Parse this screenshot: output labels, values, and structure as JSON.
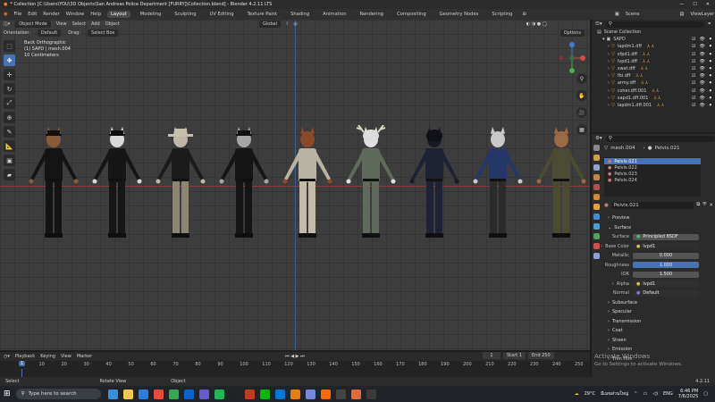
{
  "window": {
    "title": "* Collection [C:\\Users\\YOU\\3D Objects\\San Andreas Police Department [FURRY]\\Collection.blend] - Blender 4.2.11 LTS",
    "controls": [
      "—",
      "☐",
      "✕"
    ]
  },
  "menubar": {
    "menus": [
      "File",
      "Edit",
      "Render",
      "Window",
      "Help"
    ],
    "workspaces": [
      "Layout",
      "Modeling",
      "Sculpting",
      "UV Editing",
      "Texture Paint",
      "Shading",
      "Animation",
      "Rendering",
      "Compositing",
      "Geometry Nodes",
      "Scripting"
    ],
    "active_workspace": "Layout",
    "scene": "Scene",
    "view_layer": "ViewLayer"
  },
  "viewport_header": {
    "mode": "Object Mode",
    "menus": [
      "View",
      "Select",
      "Add",
      "Object"
    ],
    "transform": "Global",
    "orientation_label": "Orientation:",
    "orientation_value": "Default",
    "drag_label": "Drag:",
    "drag_value": "Select Box",
    "options": "Options"
  },
  "viewport_info": {
    "view": "Back Orthographic",
    "object": "(1) SAPD | mesh.004",
    "scale": "10 Centimeters"
  },
  "characters": [
    {
      "name": "police-officer-dog",
      "head": "#8a5b3a",
      "uniform": "#141414",
      "pants": "#141414",
      "hat": "cap"
    },
    {
      "name": "raccoon-officer",
      "head": "#d8d8d8",
      "uniform": "#161616",
      "pants": "#161616",
      "hat": "cap"
    },
    {
      "name": "sheriff-deputy",
      "head": "#bfb6a9",
      "uniform": "#1b1b1b",
      "pants": "#8c8574",
      "hat": "stetson"
    },
    {
      "name": "officer-dog-2",
      "head": "#a6a6a6",
      "uniform": "#151515",
      "pants": "#151515",
      "hat": "cap"
    },
    {
      "name": "fox-civilian",
      "head": "#8a4a2a",
      "uniform": "#b9b3a6",
      "pants": "#c4bca8",
      "hat": "none"
    },
    {
      "name": "antler-pilot",
      "head": "#e0e0e0",
      "uniform": "#5f6a5d",
      "pants": "#5f6a5d",
      "hat": "helmet"
    },
    {
      "name": "swat-officer",
      "head": "#1a1a26",
      "uniform": "#1e2233",
      "pants": "#1e2233",
      "hat": "helmet"
    },
    {
      "name": "wolf-detective",
      "head": "#c9c9c9",
      "uniform": "#243768",
      "pants": "#2a2a2a",
      "hat": "none"
    },
    {
      "name": "camo-soldier",
      "head": "#9a6a44",
      "uniform": "#4b4a33",
      "pants": "#4b4a33",
      "hat": "none"
    }
  ],
  "timeline": {
    "menus": [
      "Playback",
      "Keying",
      "View",
      "Marker"
    ],
    "current_frame": "1",
    "start_label": "Start",
    "start": "1",
    "end_label": "End",
    "end": "250",
    "ticks": [
      "1",
      "10",
      "20",
      "30",
      "40",
      "50",
      "60",
      "70",
      "80",
      "90",
      "100",
      "110",
      "120",
      "130",
      "140",
      "150",
      "160",
      "170",
      "180",
      "190",
      "200",
      "210",
      "220",
      "230",
      "240",
      "250"
    ]
  },
  "statusbar": {
    "items": [
      "Select",
      "Rotate View",
      "Object"
    ],
    "version": "4.2.11"
  },
  "outliner": {
    "search_placeholder": "",
    "root": "Scene Collection",
    "collection": "SAPD",
    "items": [
      "lapdm1.dff",
      "sfpd1.dff",
      "lvpd1.dff",
      "swat.dff",
      "fbi.dff",
      "army.dff",
      "csher.dff.001",
      "sapd1.dff.001",
      "lapdm1.dff.001"
    ]
  },
  "properties": {
    "object": "mesh.004",
    "material_breadcrumb": "Pelvis.021",
    "slots": [
      "Pelvis.021",
      "Pelvis.022",
      "Pelvis.023",
      "Pelvis.024"
    ],
    "selected_slot": "Pelvis.021",
    "material_name": "Pelvis.021",
    "sections": {
      "preview": "Preview",
      "surface": "Surface",
      "subsurface": "Subsurface",
      "specular": "Specular",
      "transmission": "Transmission",
      "coat": "Coat",
      "sheen": "Sheen",
      "emission": "Emission",
      "thin_film": "Thin Film"
    },
    "fields": {
      "surface_label": "Surface",
      "surface_value": "Principled BSDF",
      "base_color_label": "Base Color",
      "base_color_value": "lvpd1",
      "metallic_label": "Metallic",
      "metallic_value": "0.000",
      "roughness_label": "Roughness",
      "roughness_value": "1.000",
      "ior_label": "IOR",
      "ior_value": "1.500",
      "alpha_label": "Alpha",
      "alpha_value": "lvpd1",
      "normal_label": "Normal",
      "normal_value": "Default"
    }
  },
  "activation": {
    "title": "Activate Windows",
    "subtitle": "Go to Settings to activate Windows."
  },
  "taskbar": {
    "search_placeholder": "Type here to search",
    "weather": "29°C",
    "weather_text": "มีเมฆส่วนใหญ่",
    "language": "ENG",
    "time": "6:46 PM",
    "date": "7/6/2025",
    "apps": [
      "#3b8fdc",
      "#f2c94c",
      "#2d7de0",
      "#e74c3c",
      "#34a853",
      "#0a64c8",
      "#6a5acd",
      "#1db954",
      "#222",
      "#c23b22",
      "#00b900",
      "#0078d4",
      "#e87d0d",
      "#7289da",
      "#ff6a00",
      "#444",
      "#e06c3c",
      "#3a3a3a"
    ]
  }
}
